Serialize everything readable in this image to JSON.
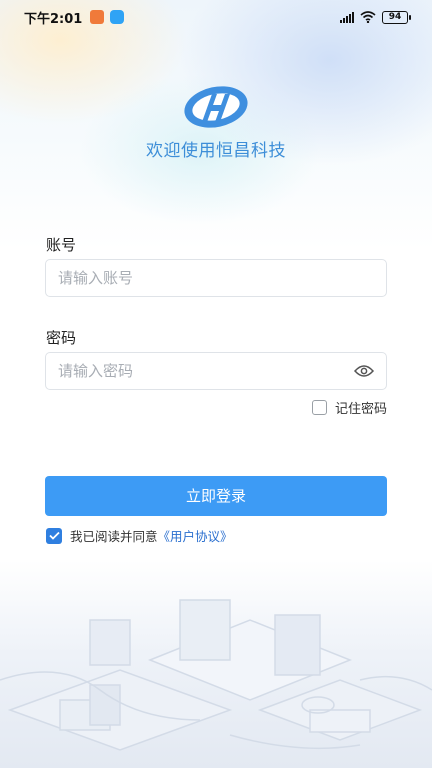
{
  "status_bar": {
    "time": "下午2:01",
    "battery": "94",
    "icons": [
      "taobao-app-icon",
      "message-app-icon",
      "signal-icon",
      "wifi-icon",
      "battery-icon"
    ]
  },
  "brand": {
    "welcome": "欢迎使用恒昌科技",
    "logo_icon": "hengchang-logo-icon"
  },
  "form": {
    "account_label": "账号",
    "account_placeholder": "请输入账号",
    "password_label": "密码",
    "password_placeholder": "请输入密码",
    "password_toggle_icon": "eye-icon",
    "remember_label": "记住密码",
    "remember_checked": false
  },
  "login_button": "立即登录",
  "agreement": {
    "checked": true,
    "prefix": "我已阅读并同意",
    "link": "《用户协议》"
  },
  "colors": {
    "primary": "#3d9bf5",
    "brand_text": "#3d8ed8",
    "link": "#2a6fcf"
  }
}
